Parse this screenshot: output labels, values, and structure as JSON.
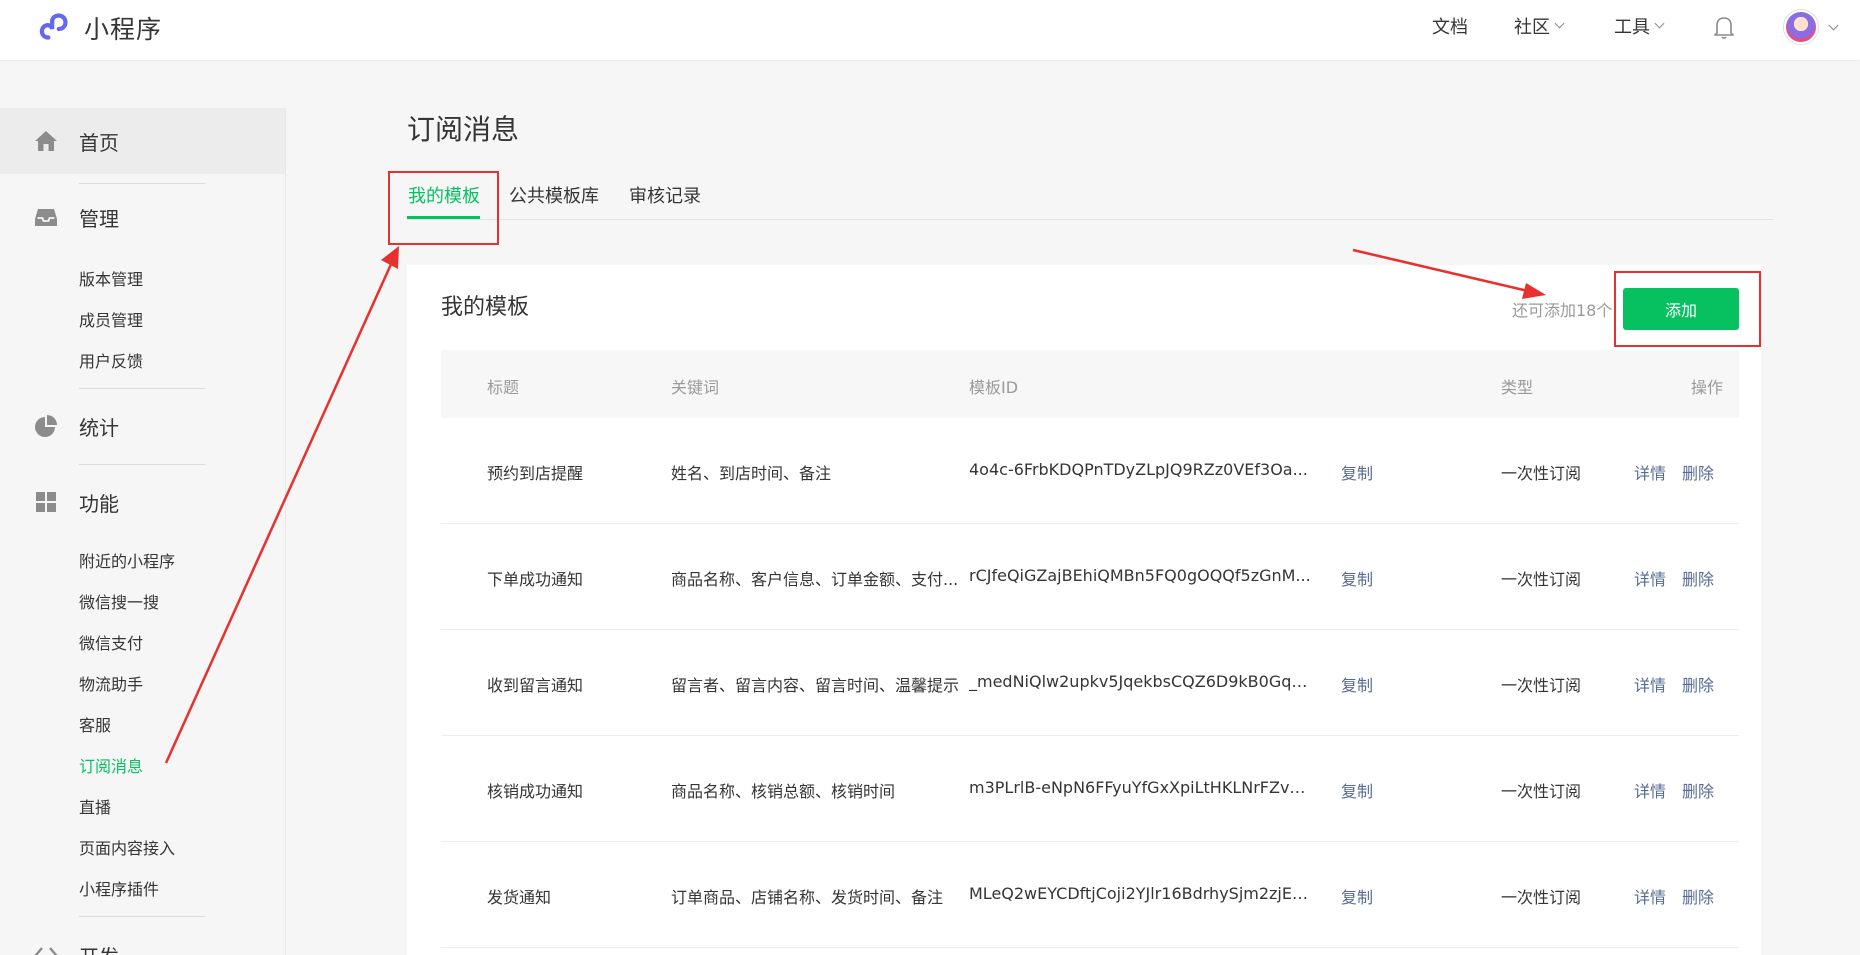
{
  "app": {
    "name": "小程序"
  },
  "topnav": {
    "docs": "文档",
    "community": "社区",
    "tools": "工具"
  },
  "sidebar": {
    "home": "首页",
    "manage": {
      "label": "管理",
      "items": [
        "版本管理",
        "成员管理",
        "用户反馈"
      ]
    },
    "stats": {
      "label": "统计"
    },
    "features": {
      "label": "功能",
      "items": [
        "附近的小程序",
        "微信搜一搜",
        "微信支付",
        "物流助手",
        "客服",
        "订阅消息",
        "直播",
        "页面内容接入",
        "小程序插件"
      ]
    },
    "dev": {
      "label": "开发"
    }
  },
  "page": {
    "title": "订阅消息",
    "tabs": [
      "我的模板",
      "公共模板库",
      "审核记录"
    ]
  },
  "card": {
    "title": "我的模板",
    "remain": "还可添加18个",
    "add_label": "添加",
    "columns": [
      "标题",
      "关键词",
      "模板ID",
      "类型",
      "操作"
    ],
    "rows": [
      {
        "title": "预约到店提醒",
        "keywords": "姓名、到店时间、备注",
        "template_id": "4o4c-6FrbKDQPnTDyZLpJQ9RZz0VEf3Oa...",
        "copy": "复制",
        "type": "一次性订阅",
        "detail": "详情",
        "delete": "删除"
      },
      {
        "title": "下单成功通知",
        "keywords": "商品名称、客户信息、订单金额、支付...",
        "template_id": "rCJfeQiGZajBEhiQMBn5FQ0gOQQf5zGnM...",
        "copy": "复制",
        "type": "一次性订阅",
        "detail": "详情",
        "delete": "删除"
      },
      {
        "title": "收到留言通知",
        "keywords": "留言者、留言内容、留言时间、温馨提示",
        "template_id": "_medNiQlw2upkv5JqekbsCQZ6D9kB0GqD...",
        "copy": "复制",
        "type": "一次性订阅",
        "detail": "详情",
        "delete": "删除"
      },
      {
        "title": "核销成功通知",
        "keywords": "商品名称、核销总额、核销时间",
        "template_id": "m3PLrlB-eNpN6FFyuYfGxXpiLtHKLNrFZvS...",
        "copy": "复制",
        "type": "一次性订阅",
        "detail": "详情",
        "delete": "删除"
      },
      {
        "title": "发货通知",
        "keywords": "订单商品、店铺名称、发货时间、备注",
        "template_id": "MLeQ2wEYCDftjCoji2YJlr16BdrhySjm2zjEh...",
        "copy": "复制",
        "type": "一次性订阅",
        "detail": "详情",
        "delete": "删除"
      }
    ]
  },
  "colors": {
    "accent": "#07c160",
    "link": "#576b95",
    "annotation": "#e8302f"
  }
}
